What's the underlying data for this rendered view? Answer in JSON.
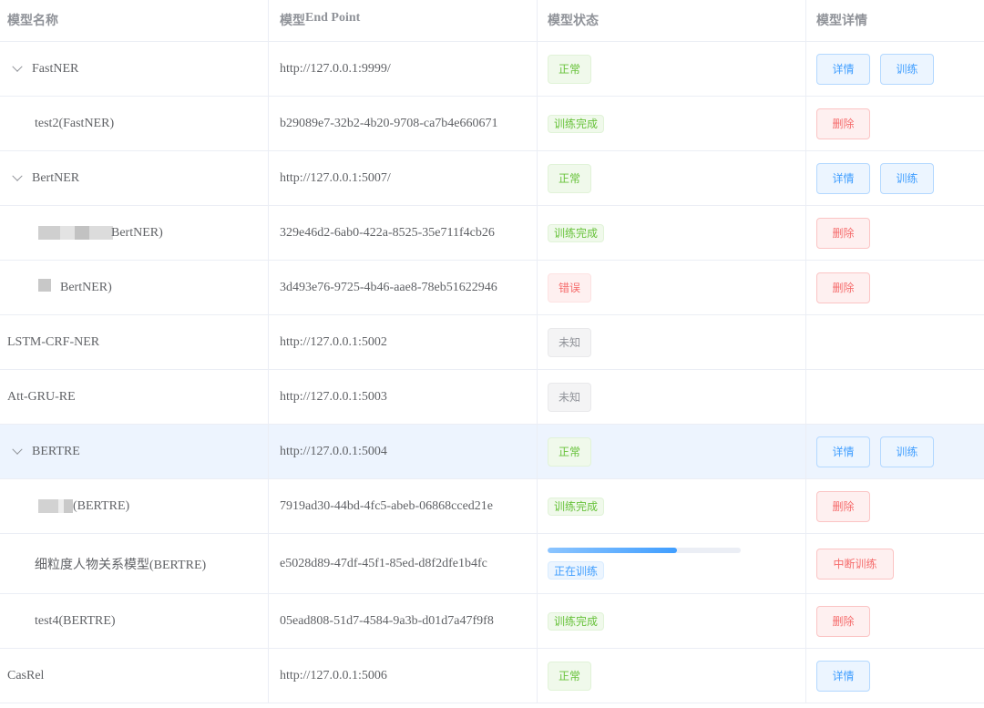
{
  "headers": {
    "name": "模型名称",
    "endpoint_prefix": "模型 ",
    "endpoint_bold": "End Point",
    "status": "模型状态",
    "details": "模型详情"
  },
  "rows": [
    {
      "name": "FastNER",
      "endpoint": "http://127.0.0.1:9999/",
      "status": "正常",
      "btn1": "详情",
      "btn2": "训练"
    },
    {
      "name": "test2(FastNER)",
      "endpoint": "b29089e7-32b2-4b20-9708-ca7b4e660671",
      "status": "训练完成",
      "btn1": "删除"
    },
    {
      "name": "BertNER",
      "endpoint": "http://127.0.0.1:5007/",
      "status": "正常",
      "btn1": "详情",
      "btn2": "训练"
    },
    {
      "name": "BertNER)",
      "endpoint": "329e46d2-6ab0-422a-8525-35e711f4cb26",
      "status": "训练完成",
      "btn1": "删除"
    },
    {
      "name": "BertNER)",
      "endpoint": "3d493e76-9725-4b46-aae8-78eb51622946",
      "status": "错误",
      "btn1": "删除"
    },
    {
      "name": "LSTM-CRF-NER",
      "endpoint": "http://127.0.0.1:5002",
      "status": "未知"
    },
    {
      "name": "Att-GRU-RE",
      "endpoint": "http://127.0.0.1:5003",
      "status": "未知"
    },
    {
      "name": "BERTRE",
      "endpoint": "http://127.0.0.1:5004",
      "status": "正常",
      "btn1": "详情",
      "btn2": "训练"
    },
    {
      "name": "(BERTRE)",
      "endpoint": "7919ad30-44bd-4fc5-abeb-06868cced21e",
      "status": "训练完成",
      "btn1": "删除"
    },
    {
      "name": "细粒度人物关系模型(BERTRE)",
      "endpoint": "e5028d89-47df-45f1-85ed-d8f2dfe1b4fc",
      "status": "正在训练",
      "progress": 0.67,
      "btn1": "中断训练"
    },
    {
      "name": "test4(BERTRE)",
      "endpoint": "05ead808-51d7-4584-9a3b-d01d7a47f9f8",
      "status": "训练完成",
      "btn1": "删除"
    },
    {
      "name": "CasRel",
      "endpoint": "http://127.0.0.1:5006",
      "status": "正常",
      "btn1": "详情"
    }
  ],
  "colors": {
    "success": "#67c23a",
    "danger": "#f56c6c",
    "info": "#909399",
    "primary": "#409eff",
    "row_selected": "#edf4fe"
  },
  "icons": {
    "expand": "chevron-down-icon"
  }
}
